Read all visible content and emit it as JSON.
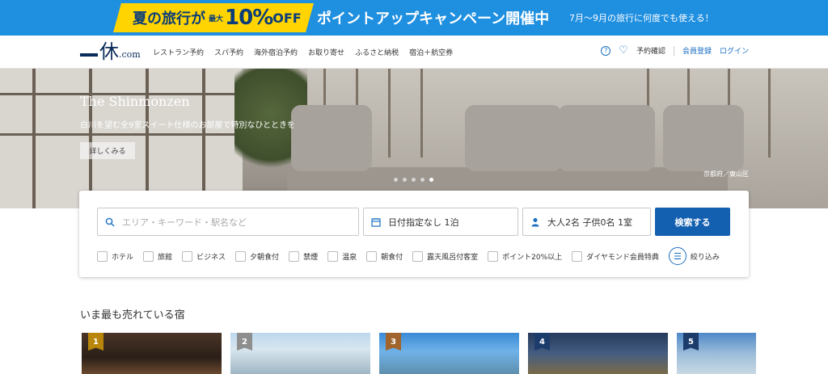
{
  "colors": {
    "promo_bg": "#1f8fe0",
    "promo_yellow": "#ffd400",
    "accent": "#1b6fc2",
    "search_button": "#1460b0",
    "rank_gold": "#b8860b",
    "rank_silver": "#8e8e8e",
    "rank_bronze": "#a0642c",
    "rank_blue": "#1c3c6c"
  },
  "promo": {
    "yellow_text": "夏の旅行が",
    "max_text": "最大",
    "percent_text": "10%",
    "off_text": "OFF",
    "main_text": "ポイントアップキャンペーン開催中",
    "sub_text": "7月〜9月の旅行に何度でも使える！"
  },
  "header": {
    "logo_kanji": "休",
    "logo_com": ".com",
    "nav": [
      "レストラン予約",
      "スパ予約",
      "海外宿泊予約",
      "お取り寄せ",
      "ふるさと納税",
      "宿泊＋航空券"
    ],
    "help_icon": "question-circle-icon",
    "favorite_icon": "heart-icon",
    "booking_confirm": "予約確認",
    "register": "会員登録",
    "login": "ログイン"
  },
  "hero": {
    "title": "The Shinmonzen",
    "description": "白川を望む全9室スイート仕様のお部屋で特別なひとときを",
    "button": "詳しくみる",
    "location": "京都府／東山区",
    "slide_count": 5,
    "active_slide": 5
  },
  "search": {
    "keyword_placeholder": "エリア・キーワード・駅名など",
    "date_value": "日付指定なし 1泊",
    "guests_value": "大人2名 子供0名 1室",
    "search_button": "検索する",
    "filters": [
      "ホテル",
      "旅館",
      "ビジネス",
      "夕朝食付",
      "禁煙",
      "温泉",
      "朝食付",
      "露天風呂付客室",
      "ポイント20%以上",
      "ダイヤモンド会員特典"
    ],
    "narrow": "絞り込み"
  },
  "ranking": {
    "title": "いま最も売れている宿",
    "cards": [
      {
        "rank": "1"
      },
      {
        "rank": "2"
      },
      {
        "rank": "3"
      },
      {
        "rank": "4"
      },
      {
        "rank": "5"
      }
    ]
  }
}
